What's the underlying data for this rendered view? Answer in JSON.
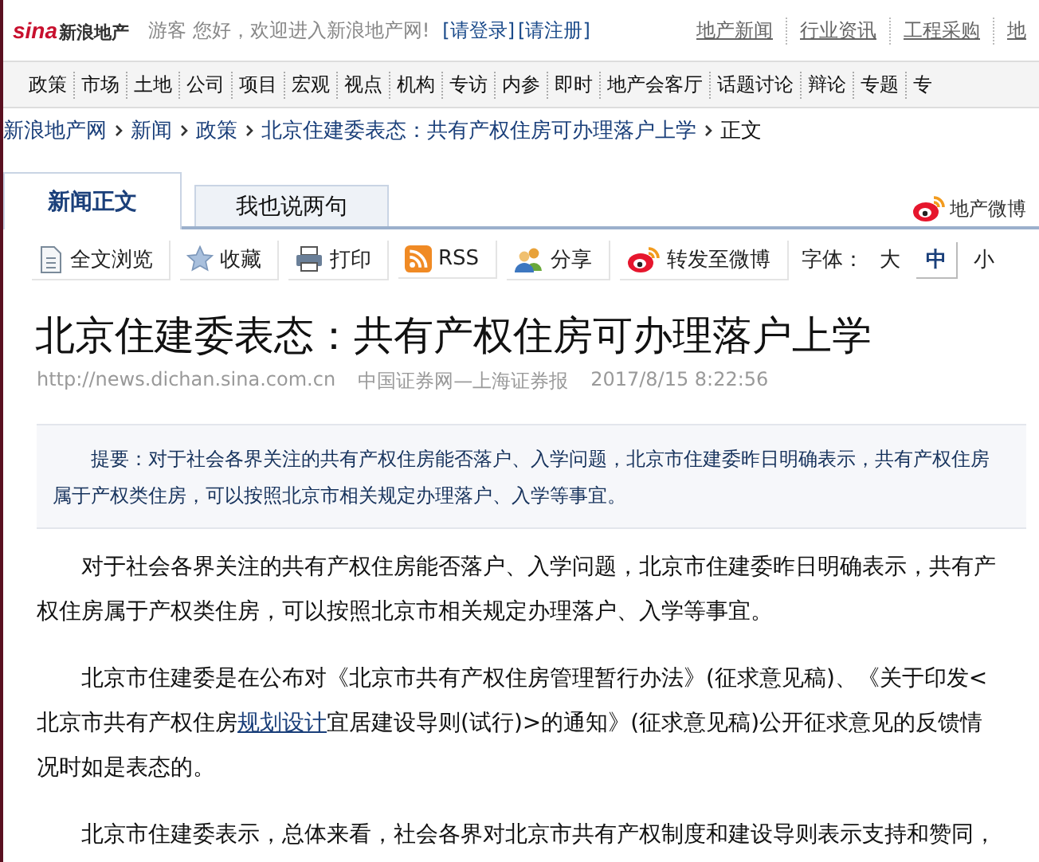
{
  "header": {
    "logo_mark": "sina",
    "logo_text": "新浪地产",
    "greeting": "游客 您好，欢迎进入新浪地产网!",
    "login": "[请登录]",
    "register": "[请注册]",
    "links": [
      "地产新闻",
      "行业资讯",
      "工程采购",
      "地"
    ]
  },
  "nav": [
    "政策",
    "市场",
    "土地",
    "公司",
    "项目",
    "宏观",
    "视点",
    "机构",
    "专访",
    "内参",
    "即时",
    "地产会客厅",
    "话题讨论",
    "辩论",
    "专题",
    "专"
  ],
  "breadcrumb": [
    "新浪地产网",
    "新闻",
    "政策",
    "北京住建委表态：共有产权住房可办理落户上学",
    "正文"
  ],
  "tabs": [
    {
      "label": "新闻正文",
      "selected": true
    },
    {
      "label": "我也说两句",
      "selected": false
    }
  ],
  "weibo": "地产微博",
  "toolbar": [
    {
      "kind": "doc",
      "label": "全文浏览"
    },
    {
      "kind": "star",
      "label": "收藏"
    },
    {
      "kind": "print",
      "label": "打印"
    },
    {
      "kind": "rss",
      "label": "RSS"
    },
    {
      "kind": "share",
      "label": "分享"
    },
    {
      "kind": "weibo",
      "label": "转发至微博"
    }
  ],
  "font_size": {
    "label": "字体：",
    "options": [
      {
        "label": "大",
        "selected": false
      },
      {
        "label": "中",
        "selected": true
      },
      {
        "label": "小",
        "selected": false
      }
    ]
  },
  "article": {
    "title": "北京住建委表态：共有产权住房可办理落户上学",
    "url": "http://news.dichan.sina.com.cn",
    "source": "中国证券网—上海证券报",
    "time": "2017/8/15 8:22:56",
    "summary_label": "提要：",
    "summary": "对于社会各界关注的共有产权住房能否落户、入学问题，北京市住建委昨日明确表示，共有产权住房属于产权类住房，可以按照北京市相关规定办理落户、入学等事宜。",
    "paragraphs": [
      [
        {
          "text": "对于社会各界关注的共有产权住房能否落户、入学问题，北京市住建委昨日明确表示，共有产权住房属于产权类住房，可以按照北京市相关规定办理落户、入学等事宜。",
          "kind": "text"
        }
      ],
      [
        {
          "text": "北京市住建委是在公布对《北京市共有产权住房管理暂行办法》(征求意见稿)、《关于印发<北京市共有产权住房",
          "kind": "text"
        },
        {
          "text": "规划设计",
          "kind": "link"
        },
        {
          "text": "宜居建设导则(试行)>的通知》(征求意见稿)公开征求意见的反馈情况时如是表态的。",
          "kind": "text"
        }
      ],
      [
        {
          "text": "北京市住建委表示，总体来看，社会各界对北京市共有产权制度和建设导则表示支持和赞同，",
          "kind": "text"
        }
      ]
    ]
  }
}
